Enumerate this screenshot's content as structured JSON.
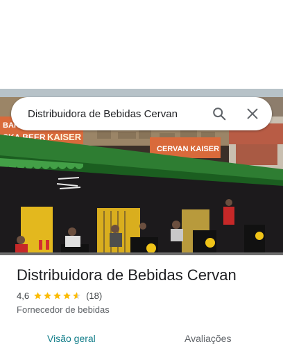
{
  "search": {
    "query": "Distribuidora de Bebidas Cervan",
    "search_icon": "search-icon",
    "close_icon": "close-icon"
  },
  "photo": {
    "sign_left": "BAR\nSKA BEER",
    "sign_mid": "KAISER",
    "sign_right": "CERVAN  KAISER"
  },
  "place": {
    "name": "Distribuidora de Bebidas Cervan",
    "rating": "4,6",
    "rating_stars": 4.6,
    "review_count": "(18)",
    "category": "Fornecedor de bebidas"
  },
  "tabs": {
    "overview": "Visão geral",
    "reviews": "Avaliações"
  },
  "colors": {
    "star": "#fbbc04",
    "active_tab": "#137e8a",
    "awning": "#2e7d32"
  }
}
